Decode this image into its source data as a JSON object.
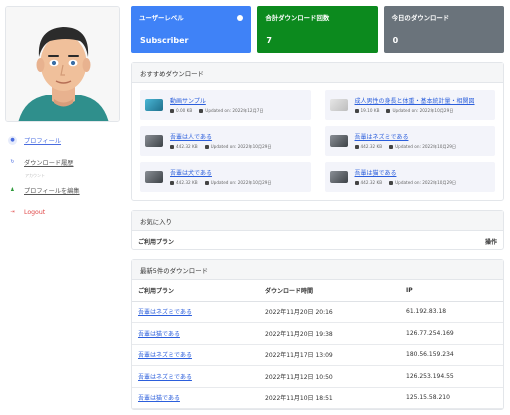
{
  "sidebar": {
    "menu": [
      {
        "label": "プロフィール",
        "icon": "profile-icon",
        "color": "#4a6de0"
      },
      {
        "label": "ダウンロード履歴",
        "icon": "history-icon",
        "color": "#4a6de0"
      },
      {
        "label": "プロフィールを編集",
        "icon": "user-edit-icon",
        "color": "#2e9a3a"
      },
      {
        "label": "Logout",
        "icon": "logout-icon",
        "color": "#e04848"
      }
    ],
    "separator": "アカウント"
  },
  "stats": [
    {
      "title": "ユーザーレベル",
      "value": "Subscriber",
      "color": "#3f82f7"
    },
    {
      "title": "合計ダウンロード回数",
      "value": "7",
      "color": "#0c8a1e"
    },
    {
      "title": "今日のダウンロード",
      "value": "0",
      "color": "#6a737b"
    }
  ],
  "recommended": {
    "header": "おすすめダウンロード",
    "items": [
      {
        "title": "動画サンプル",
        "size": "0.00 KB",
        "updated": "Updated on: 2022年12月7日",
        "thumb": "video"
      },
      {
        "title": "成人男性の身長と体重・基本統計量・相関図",
        "size": "19.10 KB",
        "updated": "Updated on: 2022年10月29日",
        "thumb": "doc"
      },
      {
        "title": "吾輩は人である",
        "size": "442.32 KB",
        "updated": "Updated on: 2022年10月29日",
        "thumb": "book"
      },
      {
        "title": "吾輩はネズミである",
        "size": "442.32 KB",
        "updated": "Updated on: 2022年10月29日",
        "thumb": "book"
      },
      {
        "title": "吾輩は犬である",
        "size": "442.32 KB",
        "updated": "Updated on: 2022年10月29日",
        "thumb": "book"
      },
      {
        "title": "吾輩は猫である",
        "size": "442.32 KB",
        "updated": "Updated on: 2022年10月29日",
        "thumb": "book"
      }
    ]
  },
  "favorites": {
    "header": "お気に入り",
    "col_plan": "ご利用プラン",
    "col_action": "操作"
  },
  "recent": {
    "header": "最新5件のダウンロード",
    "columns": [
      "ご利用プラン",
      "ダウンロード時間",
      "IP"
    ],
    "rows": [
      [
        "吾輩はネズミである",
        "2022年11月20日 20:16",
        "61.192.83.18"
      ],
      [
        "吾輩は猫である",
        "2022年11月20日 19:38",
        "126.77.254.169"
      ],
      [
        "吾輩はネズミである",
        "2022年11月17日 13:09",
        "180.56.159.234"
      ],
      [
        "吾輩はネズミである",
        "2022年11月12日 10:50",
        "126.253.194.55"
      ],
      [
        "吾輩は猫である",
        "2022年11月10日 18:51",
        "125.15.58.210"
      ]
    ]
  }
}
